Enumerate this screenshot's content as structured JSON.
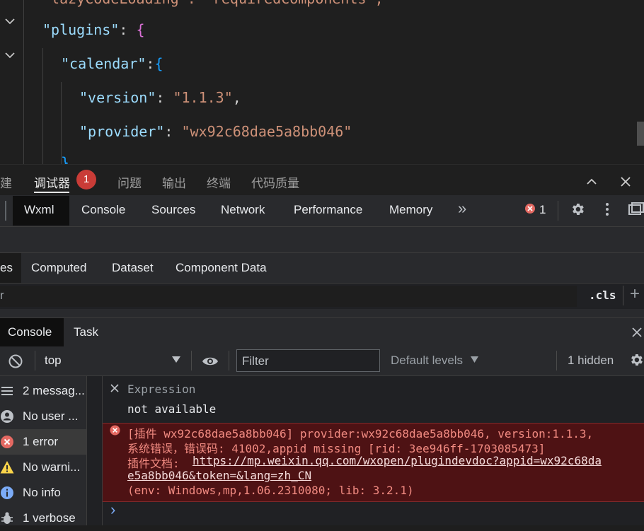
{
  "editor": {
    "line_top_partial": "\"lazyCodeLoading\": \"requiredComponents\",",
    "plugins_key": "\"plugins\"",
    "calendar_key": "\"calendar\"",
    "version_key": "\"version\"",
    "version_value": "\"1.1.3\"",
    "provider_key": "\"provider\"",
    "provider_value": "\"wx92c68dae5a8bb046\"",
    "colon": ": ",
    "colon_tight": ":",
    "comma": ",",
    "open_brace": "{",
    "close_brace_partial": "}"
  },
  "panel_tabs": {
    "items": [
      "建",
      "调试器",
      "问题",
      "输出",
      "终端",
      "代码质量"
    ],
    "badge": "1"
  },
  "devtools_tabs": {
    "items": [
      "Wxml",
      "Console",
      "Sources",
      "Network",
      "Performance",
      "Memory"
    ],
    "more": "»",
    "error_count": "1"
  },
  "styles_tabs": {
    "items": [
      "es",
      "Computed",
      "Dataset",
      "Component Data"
    ],
    "filter_partial": "r",
    "cls_label": ".cls",
    "plus": "+"
  },
  "drawer_tabs": {
    "items": [
      "Console",
      "Task"
    ],
    "close": "✕"
  },
  "console_toolbar": {
    "context": "top",
    "filter_placeholder": "Filter",
    "levels": "Default levels",
    "hidden": "1 hidden"
  },
  "sidebar": {
    "items": [
      {
        "label": "2 messag...",
        "icon": "list-icon"
      },
      {
        "label": "No user ...",
        "icon": "user-icon"
      },
      {
        "label": "1 error",
        "icon": "error-icon"
      },
      {
        "label": "No warni...",
        "icon": "warning-icon"
      },
      {
        "label": "No info",
        "icon": "info-icon"
      },
      {
        "label": "1 verbose",
        "icon": "bug-icon"
      }
    ]
  },
  "console": {
    "expression_label": "Expression",
    "expression_value": "not available",
    "error_line1": "[插件 wx92c68dae5a8bb046] provider:wx92c68dae5a8bb046, version:1.1.3,",
    "error_line2": "系统错误，错误码: 41002,appid missing [rid: 3ee946ff-1703085473]",
    "error_line3_prefix": "插件文档: ",
    "error_link_a": "https://mp.weixin.qq.com/wxopen/plugindevdoc?appid=wx92c68da",
    "error_link_b": "e5a8bb046&token=&lang=zh_CN",
    "error_line5": "(env: Windows,mp,1.06.2310080; lib: 3.2.1)",
    "prompt": "›"
  },
  "colors": {
    "error_badge": "#c93c37",
    "error_bg": "#4e1214",
    "error_text": "#f28b82",
    "string": "#ce9178",
    "key": "#9cdcfe"
  }
}
